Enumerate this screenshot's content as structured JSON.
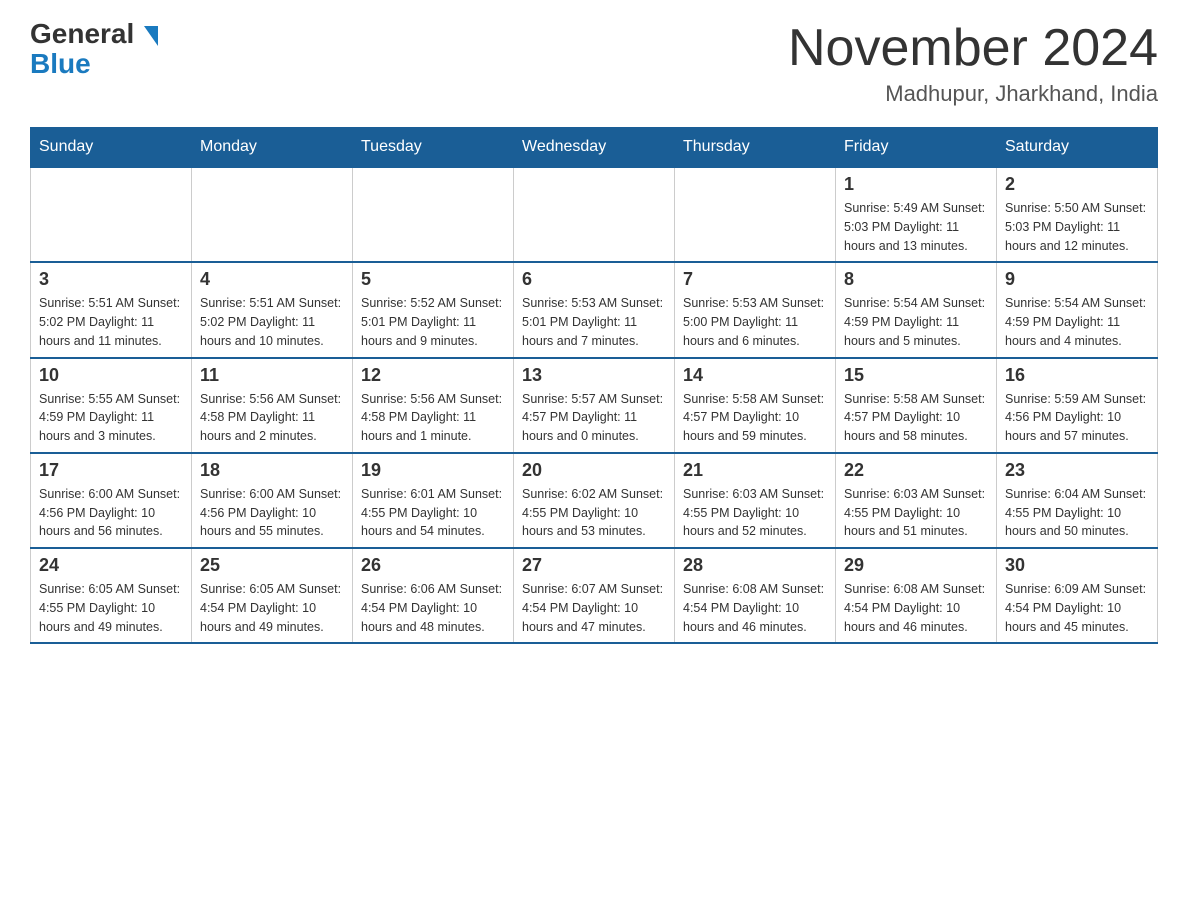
{
  "header": {
    "logo_general": "General",
    "logo_blue": "Blue",
    "month_title": "November 2024",
    "location": "Madhupur, Jharkhand, India"
  },
  "weekdays": [
    "Sunday",
    "Monday",
    "Tuesday",
    "Wednesday",
    "Thursday",
    "Friday",
    "Saturday"
  ],
  "weeks": [
    [
      {
        "day": "",
        "info": ""
      },
      {
        "day": "",
        "info": ""
      },
      {
        "day": "",
        "info": ""
      },
      {
        "day": "",
        "info": ""
      },
      {
        "day": "",
        "info": ""
      },
      {
        "day": "1",
        "info": "Sunrise: 5:49 AM\nSunset: 5:03 PM\nDaylight: 11 hours\nand 13 minutes."
      },
      {
        "day": "2",
        "info": "Sunrise: 5:50 AM\nSunset: 5:03 PM\nDaylight: 11 hours\nand 12 minutes."
      }
    ],
    [
      {
        "day": "3",
        "info": "Sunrise: 5:51 AM\nSunset: 5:02 PM\nDaylight: 11 hours\nand 11 minutes."
      },
      {
        "day": "4",
        "info": "Sunrise: 5:51 AM\nSunset: 5:02 PM\nDaylight: 11 hours\nand 10 minutes."
      },
      {
        "day": "5",
        "info": "Sunrise: 5:52 AM\nSunset: 5:01 PM\nDaylight: 11 hours\nand 9 minutes."
      },
      {
        "day": "6",
        "info": "Sunrise: 5:53 AM\nSunset: 5:01 PM\nDaylight: 11 hours\nand 7 minutes."
      },
      {
        "day": "7",
        "info": "Sunrise: 5:53 AM\nSunset: 5:00 PM\nDaylight: 11 hours\nand 6 minutes."
      },
      {
        "day": "8",
        "info": "Sunrise: 5:54 AM\nSunset: 4:59 PM\nDaylight: 11 hours\nand 5 minutes."
      },
      {
        "day": "9",
        "info": "Sunrise: 5:54 AM\nSunset: 4:59 PM\nDaylight: 11 hours\nand 4 minutes."
      }
    ],
    [
      {
        "day": "10",
        "info": "Sunrise: 5:55 AM\nSunset: 4:59 PM\nDaylight: 11 hours\nand 3 minutes."
      },
      {
        "day": "11",
        "info": "Sunrise: 5:56 AM\nSunset: 4:58 PM\nDaylight: 11 hours\nand 2 minutes."
      },
      {
        "day": "12",
        "info": "Sunrise: 5:56 AM\nSunset: 4:58 PM\nDaylight: 11 hours\nand 1 minute."
      },
      {
        "day": "13",
        "info": "Sunrise: 5:57 AM\nSunset: 4:57 PM\nDaylight: 11 hours\nand 0 minutes."
      },
      {
        "day": "14",
        "info": "Sunrise: 5:58 AM\nSunset: 4:57 PM\nDaylight: 10 hours\nand 59 minutes."
      },
      {
        "day": "15",
        "info": "Sunrise: 5:58 AM\nSunset: 4:57 PM\nDaylight: 10 hours\nand 58 minutes."
      },
      {
        "day": "16",
        "info": "Sunrise: 5:59 AM\nSunset: 4:56 PM\nDaylight: 10 hours\nand 57 minutes."
      }
    ],
    [
      {
        "day": "17",
        "info": "Sunrise: 6:00 AM\nSunset: 4:56 PM\nDaylight: 10 hours\nand 56 minutes."
      },
      {
        "day": "18",
        "info": "Sunrise: 6:00 AM\nSunset: 4:56 PM\nDaylight: 10 hours\nand 55 minutes."
      },
      {
        "day": "19",
        "info": "Sunrise: 6:01 AM\nSunset: 4:55 PM\nDaylight: 10 hours\nand 54 minutes."
      },
      {
        "day": "20",
        "info": "Sunrise: 6:02 AM\nSunset: 4:55 PM\nDaylight: 10 hours\nand 53 minutes."
      },
      {
        "day": "21",
        "info": "Sunrise: 6:03 AM\nSunset: 4:55 PM\nDaylight: 10 hours\nand 52 minutes."
      },
      {
        "day": "22",
        "info": "Sunrise: 6:03 AM\nSunset: 4:55 PM\nDaylight: 10 hours\nand 51 minutes."
      },
      {
        "day": "23",
        "info": "Sunrise: 6:04 AM\nSunset: 4:55 PM\nDaylight: 10 hours\nand 50 minutes."
      }
    ],
    [
      {
        "day": "24",
        "info": "Sunrise: 6:05 AM\nSunset: 4:55 PM\nDaylight: 10 hours\nand 49 minutes."
      },
      {
        "day": "25",
        "info": "Sunrise: 6:05 AM\nSunset: 4:54 PM\nDaylight: 10 hours\nand 49 minutes."
      },
      {
        "day": "26",
        "info": "Sunrise: 6:06 AM\nSunset: 4:54 PM\nDaylight: 10 hours\nand 48 minutes."
      },
      {
        "day": "27",
        "info": "Sunrise: 6:07 AM\nSunset: 4:54 PM\nDaylight: 10 hours\nand 47 minutes."
      },
      {
        "day": "28",
        "info": "Sunrise: 6:08 AM\nSunset: 4:54 PM\nDaylight: 10 hours\nand 46 minutes."
      },
      {
        "day": "29",
        "info": "Sunrise: 6:08 AM\nSunset: 4:54 PM\nDaylight: 10 hours\nand 46 minutes."
      },
      {
        "day": "30",
        "info": "Sunrise: 6:09 AM\nSunset: 4:54 PM\nDaylight: 10 hours\nand 45 minutes."
      }
    ]
  ]
}
